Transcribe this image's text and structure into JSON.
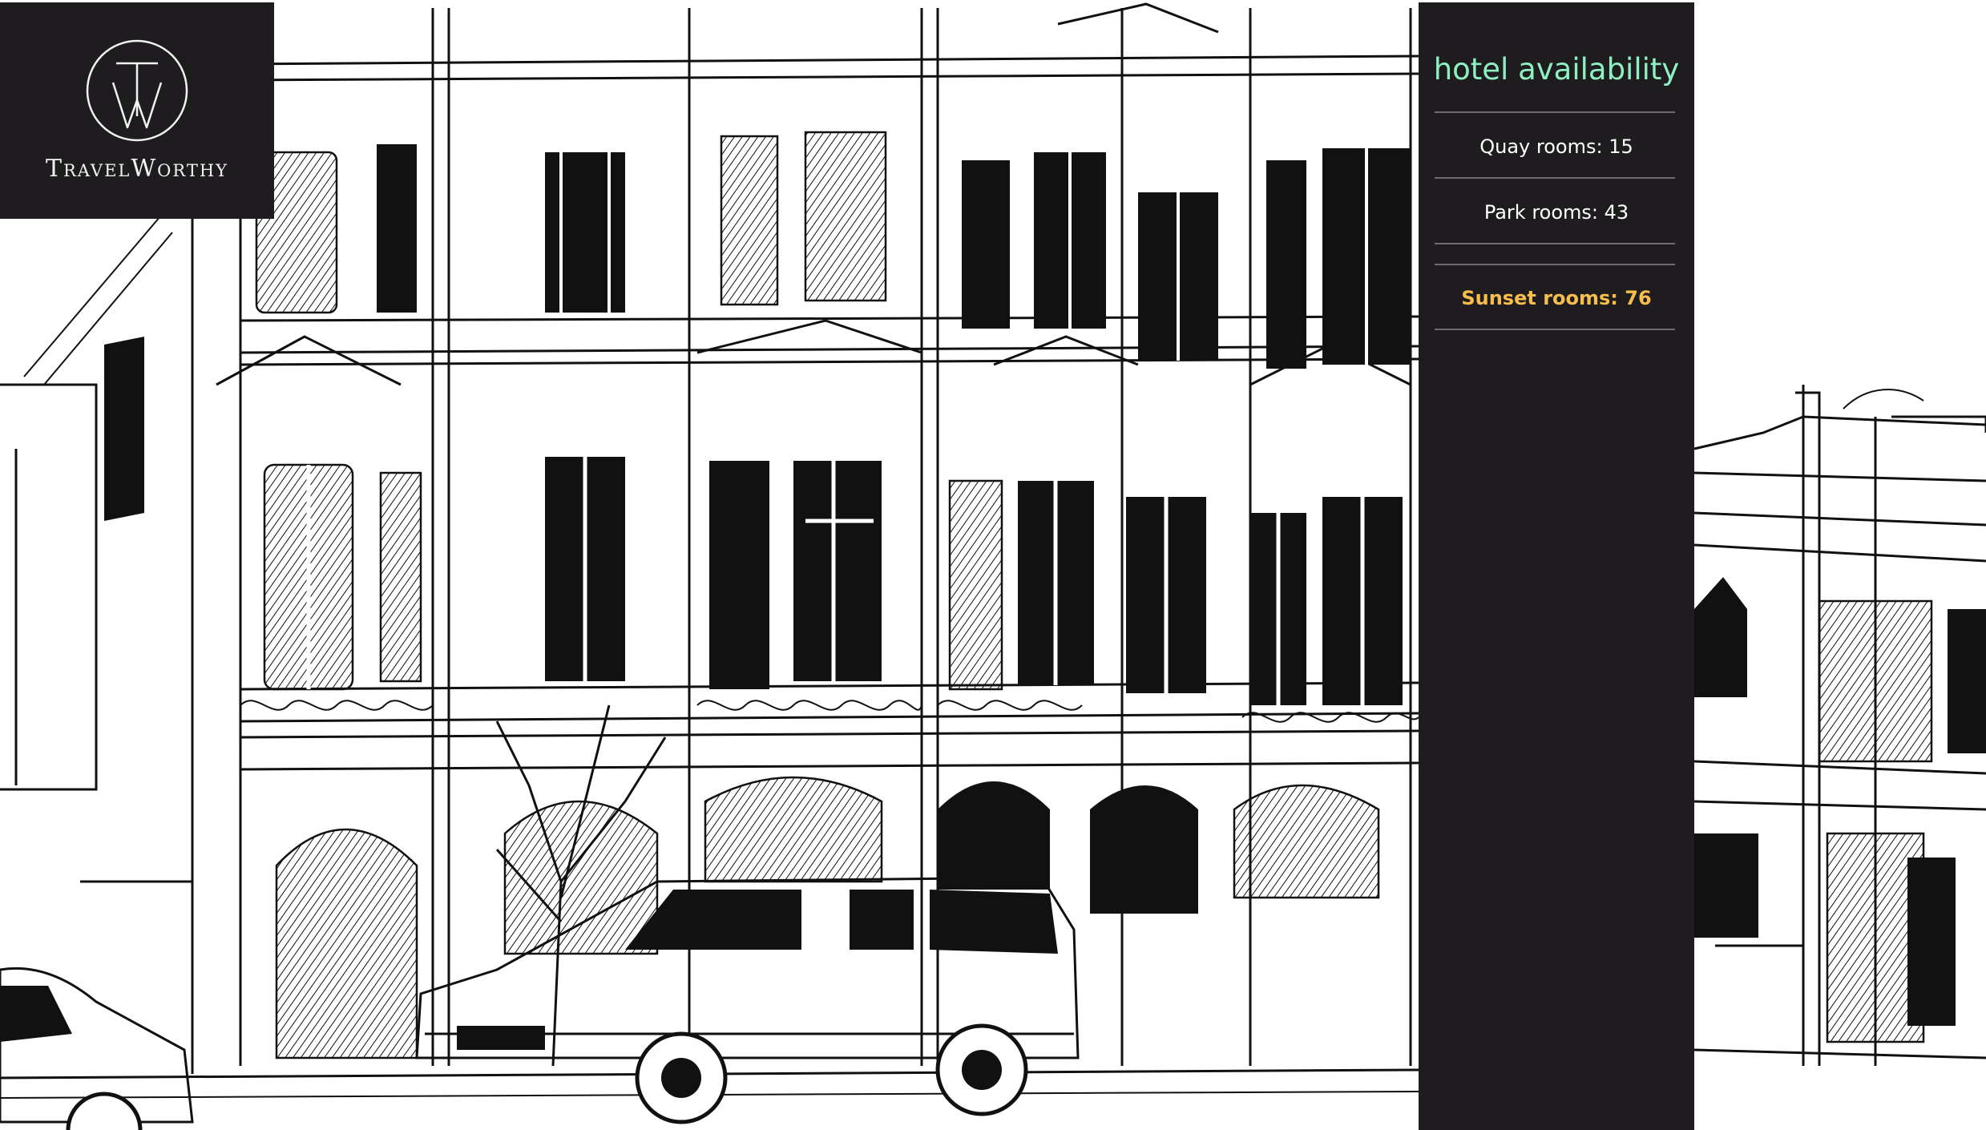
{
  "brand": {
    "name": "TravelWorthy",
    "monogram": "TW"
  },
  "availability": {
    "title": "hotel availability",
    "rooms": [
      {
        "label": "Quay rooms: 15"
      },
      {
        "label": "Park rooms: 43"
      },
      {
        "label": "Sunset rooms: 76"
      }
    ]
  },
  "colors": {
    "panel_bg": "#1e1c1f",
    "title_accent": "#8ef0c0",
    "highlight": "#f7be4d",
    "divider": "#6e6c70"
  },
  "icons": {
    "logo": "travelworthy-monogram-icon"
  }
}
